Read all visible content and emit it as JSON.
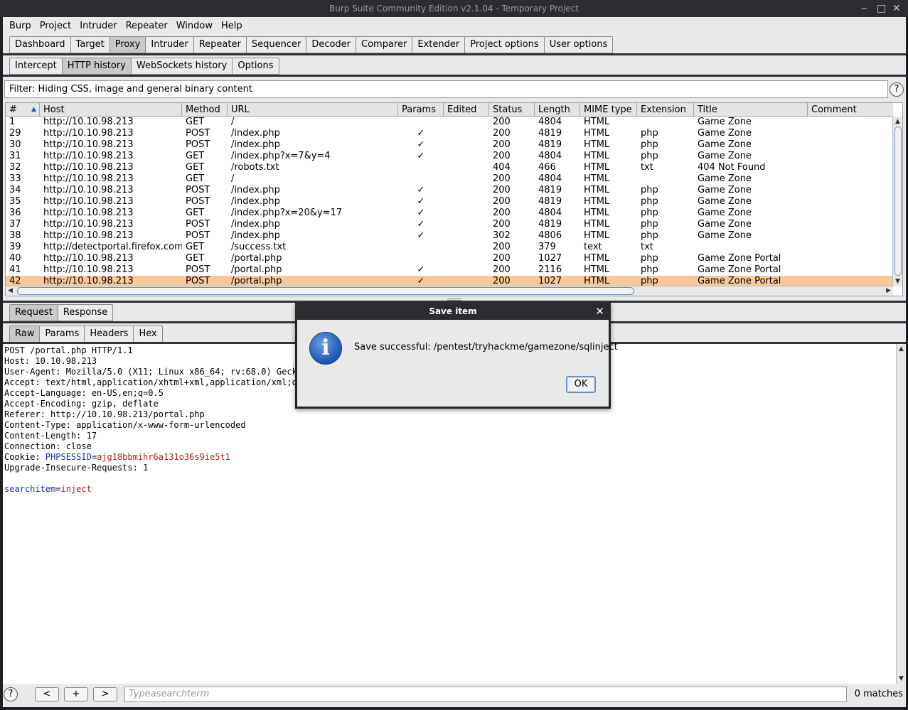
{
  "window": {
    "title": "Burp Suite Community Edition v2.1.04 - Temporary Project",
    "minimize": "‒",
    "maximize": "□",
    "close": "✕"
  },
  "menu": [
    "Burp",
    "Project",
    "Intruder",
    "Repeater",
    "Window",
    "Help"
  ],
  "main_tabs": [
    {
      "label": "Dashboard",
      "active": false
    },
    {
      "label": "Target",
      "active": false
    },
    {
      "label": "Proxy",
      "active": true
    },
    {
      "label": "Intruder",
      "active": false
    },
    {
      "label": "Repeater",
      "active": false
    },
    {
      "label": "Sequencer",
      "active": false
    },
    {
      "label": "Decoder",
      "active": false
    },
    {
      "label": "Comparer",
      "active": false
    },
    {
      "label": "Extender",
      "active": false
    },
    {
      "label": "Project options",
      "active": false
    },
    {
      "label": "User options",
      "active": false
    }
  ],
  "proxy_tabs": [
    {
      "label": "Intercept",
      "active": false
    },
    {
      "label": "HTTP history",
      "active": true
    },
    {
      "label": "WebSockets history",
      "active": false
    },
    {
      "label": "Options",
      "active": false
    }
  ],
  "filter": {
    "text": "Filter: Hiding CSS, image and general binary content",
    "help": "?"
  },
  "table": {
    "columns": [
      "#",
      "Host",
      "Method",
      "URL",
      "Params",
      "Edited",
      "Status",
      "Length",
      "MIME type",
      "Extension",
      "Title",
      "Comment"
    ],
    "sort_indicator": "▲",
    "rows": [
      {
        "num": "1",
        "host": "http://10.10.98.213",
        "method": "GET",
        "url": "/",
        "params": "",
        "edited": "",
        "status": "200",
        "length": "4804",
        "mime": "HTML",
        "ext": "",
        "title": "Game Zone",
        "comment": ""
      },
      {
        "num": "29",
        "host": "http://10.10.98.213",
        "method": "POST",
        "url": "/index.php",
        "params": "✓",
        "edited": "",
        "status": "200",
        "length": "4819",
        "mime": "HTML",
        "ext": "php",
        "title": "Game Zone",
        "comment": ""
      },
      {
        "num": "30",
        "host": "http://10.10.98.213",
        "method": "POST",
        "url": "/index.php",
        "params": "✓",
        "edited": "",
        "status": "200",
        "length": "4819",
        "mime": "HTML",
        "ext": "php",
        "title": "Game Zone",
        "comment": ""
      },
      {
        "num": "31",
        "host": "http://10.10.98.213",
        "method": "GET",
        "url": "/index.php?x=7&y=4",
        "params": "✓",
        "edited": "",
        "status": "200",
        "length": "4804",
        "mime": "HTML",
        "ext": "php",
        "title": "Game Zone",
        "comment": ""
      },
      {
        "num": "32",
        "host": "http://10.10.98.213",
        "method": "GET",
        "url": "/robots.txt",
        "params": "",
        "edited": "",
        "status": "404",
        "length": "466",
        "mime": "HTML",
        "ext": "txt",
        "title": "404 Not Found",
        "comment": ""
      },
      {
        "num": "33",
        "host": "http://10.10.98.213",
        "method": "GET",
        "url": "/",
        "params": "",
        "edited": "",
        "status": "200",
        "length": "4804",
        "mime": "HTML",
        "ext": "",
        "title": "Game Zone",
        "comment": ""
      },
      {
        "num": "34",
        "host": "http://10.10.98.213",
        "method": "POST",
        "url": "/index.php",
        "params": "✓",
        "edited": "",
        "status": "200",
        "length": "4819",
        "mime": "HTML",
        "ext": "php",
        "title": "Game Zone",
        "comment": ""
      },
      {
        "num": "35",
        "host": "http://10.10.98.213",
        "method": "POST",
        "url": "/index.php",
        "params": "✓",
        "edited": "",
        "status": "200",
        "length": "4819",
        "mime": "HTML",
        "ext": "php",
        "title": "Game Zone",
        "comment": ""
      },
      {
        "num": "36",
        "host": "http://10.10.98.213",
        "method": "GET",
        "url": "/index.php?x=20&y=17",
        "params": "✓",
        "edited": "",
        "status": "200",
        "length": "4804",
        "mime": "HTML",
        "ext": "php",
        "title": "Game Zone",
        "comment": ""
      },
      {
        "num": "37",
        "host": "http://10.10.98.213",
        "method": "POST",
        "url": "/index.php",
        "params": "✓",
        "edited": "",
        "status": "200",
        "length": "4819",
        "mime": "HTML",
        "ext": "php",
        "title": "Game Zone",
        "comment": ""
      },
      {
        "num": "38",
        "host": "http://10.10.98.213",
        "method": "POST",
        "url": "/index.php",
        "params": "✓",
        "edited": "",
        "status": "302",
        "length": "4806",
        "mime": "HTML",
        "ext": "php",
        "title": "Game Zone",
        "comment": ""
      },
      {
        "num": "39",
        "host": "http://detectportal.firefox.com",
        "method": "GET",
        "url": "/success.txt",
        "params": "",
        "edited": "",
        "status": "200",
        "length": "379",
        "mime": "text",
        "ext": "txt",
        "title": "",
        "comment": ""
      },
      {
        "num": "40",
        "host": "http://10.10.98.213",
        "method": "GET",
        "url": "/portal.php",
        "params": "",
        "edited": "",
        "status": "200",
        "length": "1027",
        "mime": "HTML",
        "ext": "php",
        "title": "Game Zone Portal",
        "comment": ""
      },
      {
        "num": "41",
        "host": "http://10.10.98.213",
        "method": "POST",
        "url": "/portal.php",
        "params": "✓",
        "edited": "",
        "status": "200",
        "length": "2116",
        "mime": "HTML",
        "ext": "php",
        "title": "Game Zone Portal",
        "comment": ""
      },
      {
        "num": "42",
        "host": "http://10.10.98.213",
        "method": "POST",
        "url": "/portal.php",
        "params": "✓",
        "edited": "",
        "status": "200",
        "length": "1027",
        "mime": "HTML",
        "ext": "php",
        "title": "Game Zone Portal",
        "comment": "",
        "selected": true
      }
    ]
  },
  "message_tabs": [
    {
      "label": "Request",
      "active": true
    },
    {
      "label": "Response",
      "active": false
    }
  ],
  "view_tabs": [
    {
      "label": "Raw",
      "active": true
    },
    {
      "label": "Params",
      "active": false
    },
    {
      "label": "Headers",
      "active": false
    },
    {
      "label": "Hex",
      "active": false
    }
  ],
  "request": {
    "lines": [
      "POST /portal.php HTTP/1.1",
      "Host: 10.10.98.213",
      "User-Agent: Mozilla/5.0 (X11; Linux x86_64; rv:68.0) Gecko/",
      "Accept: text/html,application/xhtml+xml,application/xml;q=0",
      "Accept-Language: en-US,en;q=0.5",
      "Accept-Encoding: gzip, deflate",
      "Referer: http://10.10.98.213/portal.php",
      "Content-Type: application/x-www-form-urlencoded",
      "Content-Length: 17",
      "Connection: close"
    ],
    "cookie_prefix": "Cookie: ",
    "cookie_name": "PHPSESSID",
    "cookie_eq": "=",
    "cookie_value": "ajg18bbmihr6a131o36s9ie5t1",
    "upgrade_line": "Upgrade-Insecure-Requests: 1",
    "body_param": "searchitem",
    "body_eq": "=",
    "body_value": "inject"
  },
  "bottom": {
    "help": "?",
    "prev": "<",
    "add": "+",
    "next": ">",
    "search_placeholder": "Typeasearchterm",
    "matches": "0 matches"
  },
  "dialog": {
    "title": "Save item",
    "close": "✕",
    "icon": "i",
    "message": "Save successful: /pentest/tryhackme/gamezone/sqlinject",
    "ok": "OK"
  },
  "colors": {
    "selected_row": "#f7c89a",
    "header_key": "#1a2bbf",
    "header_value": "#b22222",
    "titlebar": "#2b2c30"
  }
}
